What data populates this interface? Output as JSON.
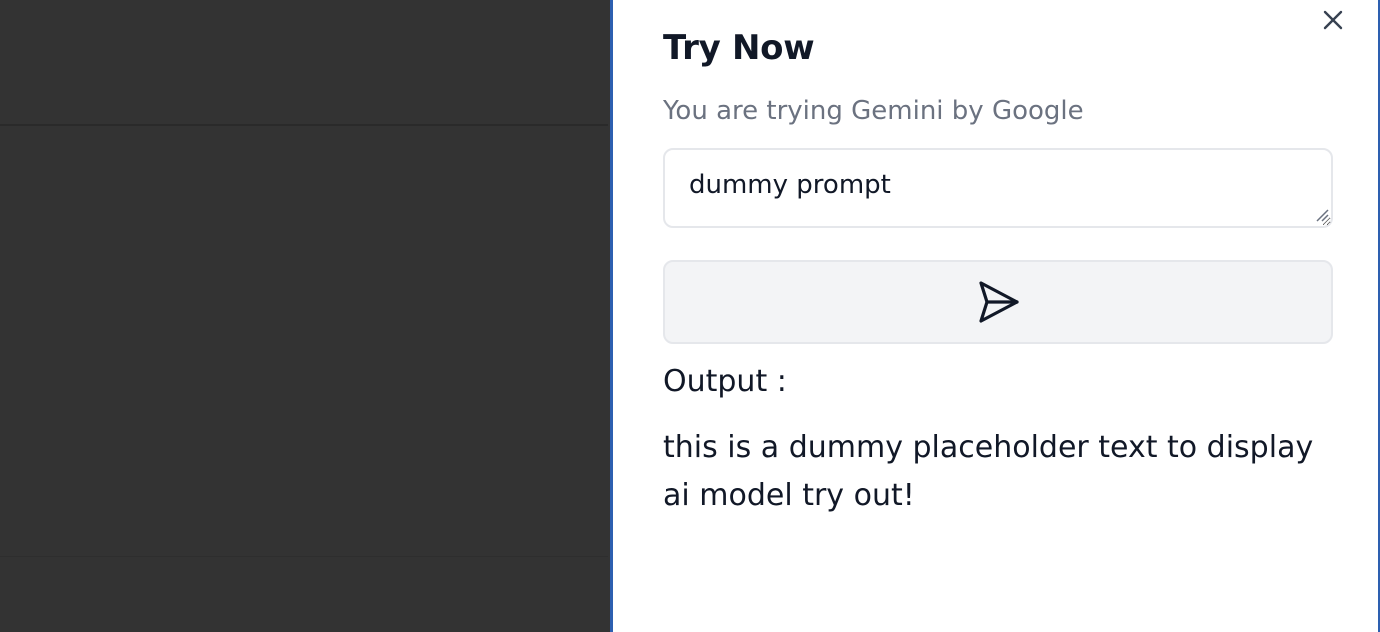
{
  "panel": {
    "title": "Try Now",
    "subtitle": "You are trying Gemini by Google",
    "close_icon": "close-icon"
  },
  "prompt": {
    "value": "dummy prompt",
    "placeholder": ""
  },
  "send": {
    "icon": "send-icon"
  },
  "output": {
    "label": "Output :",
    "text": "this is a dummy placeholder text to display ai model try out!"
  },
  "colors": {
    "backdrop": "#333333",
    "drawer_border": "#2d5fb0",
    "title": "#111827",
    "subtitle": "#6b7280",
    "button_bg": "#f3f4f6"
  }
}
